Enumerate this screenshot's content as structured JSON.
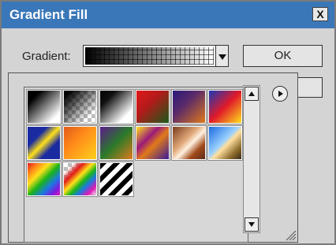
{
  "window": {
    "title": "Gradient Fill",
    "close_label": "X"
  },
  "form": {
    "gradient_label": "Gradient:",
    "ok_label": "OK"
  },
  "colors": {
    "titlebar": "#3a77b8",
    "dialog_bg": "#d4d4d4"
  },
  "icons": {
    "close": "close-icon",
    "dropdown": "chevron-down-icon",
    "scroll_up": "triangle-up-icon",
    "scroll_down": "triangle-down-icon",
    "menu": "circle-play-icon",
    "resize": "resize-grip-icon"
  },
  "swatches": [
    {
      "name": "black-white",
      "css": "linear-gradient(135deg,#000 0%,#000 20%,#fff 85%)"
    },
    {
      "name": "black-transparent",
      "css": "linear-gradient(135deg,rgba(0,0,0,1) 10%,rgba(0,0,0,0) 80%), repeating-conic-gradient(#bdbdbd 0 25%,#fff 0 50%) 0 0/10px 10px"
    },
    {
      "name": "black-white-soft",
      "css": "linear-gradient(135deg,#000 0%,#111 25%,#fff 80%)"
    },
    {
      "name": "red-green",
      "css": "linear-gradient(135deg,#e01a1a 0%,#b41a1a 40%,#1a5a1a 100%)"
    },
    {
      "name": "violet-orange",
      "css": "linear-gradient(135deg,#2a1a7a 0%,#5a2a6a 40%,#e07a1a 100%)"
    },
    {
      "name": "blue-red-yellow",
      "css": "linear-gradient(135deg,#1a3ab4 0%,#e01a2a 50%,#ffe01a 100%)"
    },
    {
      "name": "blue-yellow-blue",
      "css": "linear-gradient(135deg,#1a2aa0 0%,#1a2aa0 30%,#ffe01a 50%,#1a2aa0 70%,#1a2aa0 100%)"
    },
    {
      "name": "orange-yellow",
      "css": "linear-gradient(135deg,#e05a1a 0%,#ff8a1a 40%,#ffd01a 100%)"
    },
    {
      "name": "violet-green-orange",
      "css": "linear-gradient(135deg,#5a1a8a 0%,#2a7a2a 50%,#e07a1a 100%)"
    },
    {
      "name": "yellow-violet-orange",
      "css": "linear-gradient(135deg,#ffe01a 0%,#9a1a7a 35%,#e07a1a 55%,#3a1a9a 100%)"
    },
    {
      "name": "copper",
      "css": "linear-gradient(135deg,#7a3a1a 0%,#e0aa7a 40%,#fff0e0 55%,#a04a1a 75%,#5a2a1a 100%)"
    },
    {
      "name": "chrome",
      "css": "linear-gradient(135deg,#1a6ae0 0%,#9ad0ff 45%,#ffe0a0 55%,#8a6a2a 80%,#3a2a1a 100%)"
    },
    {
      "name": "spectrum",
      "css": "linear-gradient(135deg,#e01a1a 0%,#ff8a1a 18%,#ffe01a 34%,#1ab41a 52%,#1a7ae0 70%,#7a1ae0 86%,#e01ab4 100%)"
    },
    {
      "name": "transparent-rainbow",
      "css": "linear-gradient(135deg,transparent 0%,transparent 15%,#e01a1a 30%,#ffe01a 45%,#1ab41a 58%,#1a7ae0 70%,#e01ab4 85%,transparent 100%), repeating-conic-gradient(#bdbdbd 0 25%,#fff 0 50%) 0 0/10px 10px"
    },
    {
      "name": "transparent-stripes",
      "css": "repeating-linear-gradient(135deg,#000 0 6px,#fff 6px 12px), repeating-conic-gradient(#bdbdbd 0 25%,#fff 0 50%) 0 0/10px 10px"
    }
  ]
}
